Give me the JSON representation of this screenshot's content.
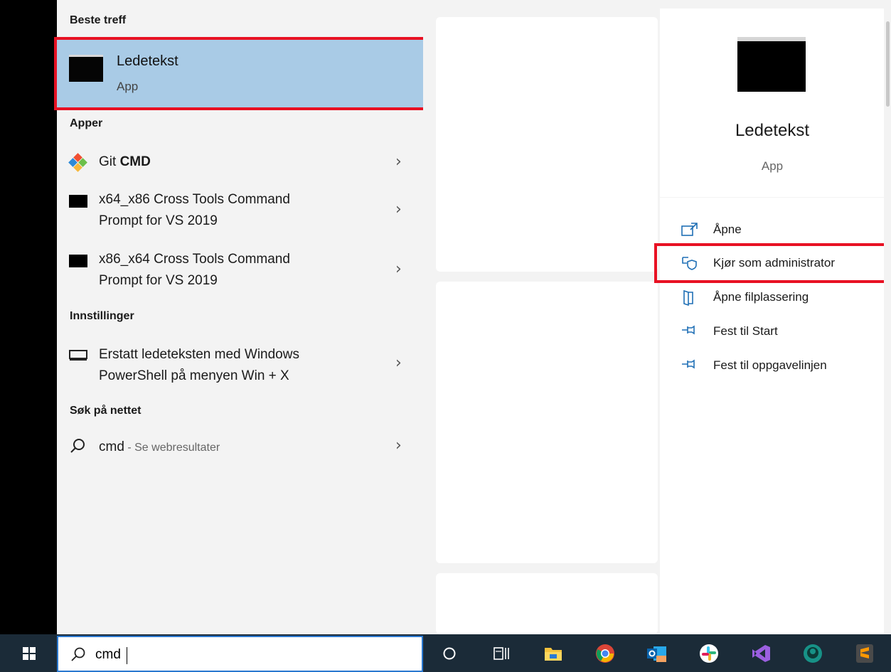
{
  "best_match": {
    "header": "Beste treff",
    "title": "Ledetekst",
    "subtitle": "App"
  },
  "apps": {
    "header": "Apper",
    "items": [
      {
        "prefix": "Git ",
        "bold": "CMD",
        "icon": "git-icon"
      },
      {
        "line1": "x64_x86 Cross Tools Command",
        "line2": "Prompt for VS 2019",
        "icon": "console-icon"
      },
      {
        "line1": "x86_x64 Cross Tools Command",
        "line2": "Prompt for VS 2019",
        "icon": "console-icon"
      }
    ]
  },
  "settings": {
    "header": "Innstillinger",
    "items": [
      {
        "line1": "Erstatt ledeteksten med Windows",
        "line2": "PowerShell på menyen Win + X",
        "icon": "display-icon"
      }
    ]
  },
  "web": {
    "header": "Søk på nettet",
    "query": "cmd",
    "suffix": " - Se webresultater"
  },
  "detail": {
    "title": "Ledetekst",
    "subtitle": "App",
    "actions": [
      {
        "label": "Åpne",
        "icon": "open-icon"
      },
      {
        "label": "Kjør som administrator",
        "icon": "shield-admin-icon"
      },
      {
        "label": "Åpne filplassering",
        "icon": "file-location-icon"
      },
      {
        "label": "Fest til Start",
        "icon": "pin-icon"
      },
      {
        "label": "Fest til oppgavelinjen",
        "icon": "pin-icon"
      }
    ]
  },
  "taskbar": {
    "search_value": "cmd",
    "icons": [
      "cortana-icon",
      "task-view-icon",
      "file-explorer-icon",
      "chrome-icon",
      "outlook-icon",
      "slack-icon",
      "visual-studio-icon",
      "gitkraken-icon",
      "sublime-text-icon"
    ]
  },
  "colors": {
    "highlight": "#a9cbe6",
    "red_annotation": "#e81123",
    "accent": "#1f6fb5",
    "taskbar": "#1b2b38"
  }
}
